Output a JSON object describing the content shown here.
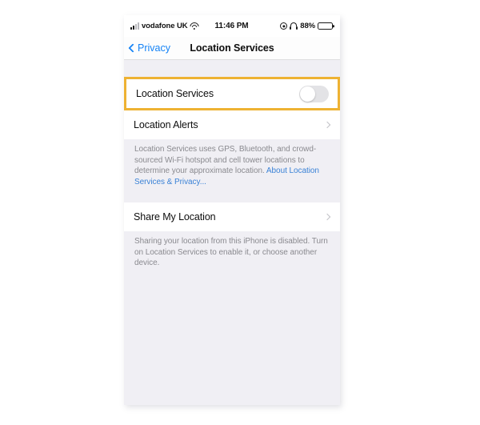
{
  "status_bar": {
    "carrier": "vodafone UK",
    "time": "11:46 PM",
    "battery_percent": "88%",
    "signal_icon": "signal-bars-icon",
    "wifi_icon": "wifi-icon",
    "location_icon": "location-arrow-icon",
    "headphones_icon": "headphones-icon",
    "battery_icon": "battery-icon"
  },
  "nav_bar": {
    "back_label": "Privacy",
    "back_icon": "chevron-left-icon",
    "title": "Location Services"
  },
  "sections": [
    {
      "rows": [
        {
          "label": "Location Services",
          "control": "toggle",
          "toggle_on": false,
          "highlighted": true
        },
        {
          "label": "Location Alerts",
          "control": "chevron",
          "highlighted": false
        }
      ],
      "footnote": {
        "text": "Location Services uses GPS, Bluetooth, and crowd-sourced Wi-Fi hotspot and cell tower locations to determine your approximate location. ",
        "link": "About Location Services & Privacy..."
      }
    },
    {
      "rows": [
        {
          "label": "Share My Location",
          "control": "chevron",
          "highlighted": false
        }
      ],
      "footnote": {
        "text": "Sharing your location from this iPhone is disabled. Turn on Location Services to enable it, or choose another device.",
        "link": ""
      }
    }
  ],
  "colors": {
    "highlight_border": "#eeb233",
    "accent_blue": "#1583f6",
    "link_blue": "#3a82d6",
    "background": "#f0eff4",
    "row_background": "#ffffff",
    "footnote_text": "#8a8a8f"
  }
}
